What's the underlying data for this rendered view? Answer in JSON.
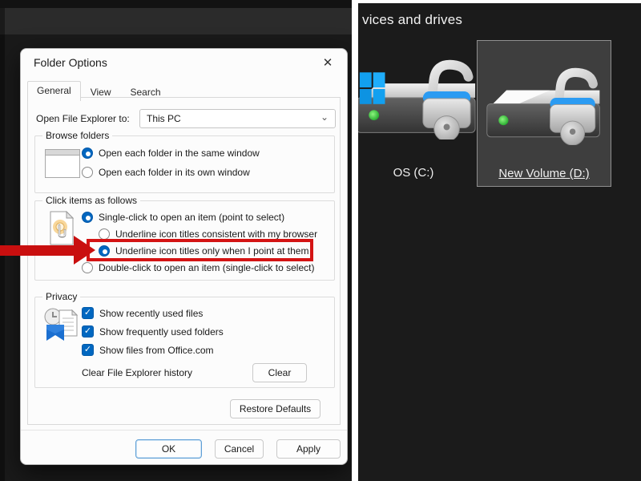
{
  "icons": {
    "close": "✕",
    "chevron_down": "⌄",
    "check": "✓"
  },
  "colors": {
    "accent_blue": "#0067c0",
    "highlight_red": "#d41414",
    "selection_gray": "#3e3e3e",
    "led_green": "#2fd142",
    "logo_blue": "#12a0f0"
  },
  "dialog": {
    "title": "Folder Options",
    "tabs": [
      {
        "label": "General",
        "active": true
      },
      {
        "label": "View",
        "active": false
      },
      {
        "label": "Search",
        "active": false
      }
    ],
    "open_to": {
      "label": "Open File Explorer to:",
      "value": "This PC"
    },
    "groups": {
      "browse": {
        "legend": "Browse folders",
        "options": [
          {
            "label": "Open each folder in the same window",
            "selected": true
          },
          {
            "label": "Open each folder in its own window",
            "selected": false
          }
        ]
      },
      "click": {
        "legend": "Click items as follows",
        "options": [
          {
            "label": "Single-click to open an item (point to select)",
            "selected": true
          },
          {
            "label": "Underline icon titles consistent with my browser",
            "selected": false
          },
          {
            "label": "Underline icon titles only when I point at them",
            "selected": true,
            "highlighted": true
          },
          {
            "label": "Double-click to open an item (single-click to select)",
            "selected": false
          }
        ]
      },
      "privacy": {
        "legend": "Privacy",
        "checkboxes": [
          {
            "label": "Show recently used files",
            "checked": true
          },
          {
            "label": "Show frequently used folders",
            "checked": true
          },
          {
            "label": "Show files from Office.com",
            "checked": true
          }
        ],
        "clear_history_label": "Clear File Explorer history",
        "clear_button": "Clear"
      }
    },
    "restore_defaults_button": "Restore Defaults",
    "footer_buttons": [
      {
        "label": "OK",
        "focused": true
      },
      {
        "label": "Cancel",
        "focused": false
      },
      {
        "label": "Apply",
        "focused": false
      }
    ]
  },
  "explorer": {
    "section_header": "vices and drives",
    "drives": [
      {
        "label": "OS (C:)",
        "selected": false,
        "underlined": false
      },
      {
        "label": "New Volume (D:)",
        "selected": true,
        "underlined": true
      }
    ]
  }
}
